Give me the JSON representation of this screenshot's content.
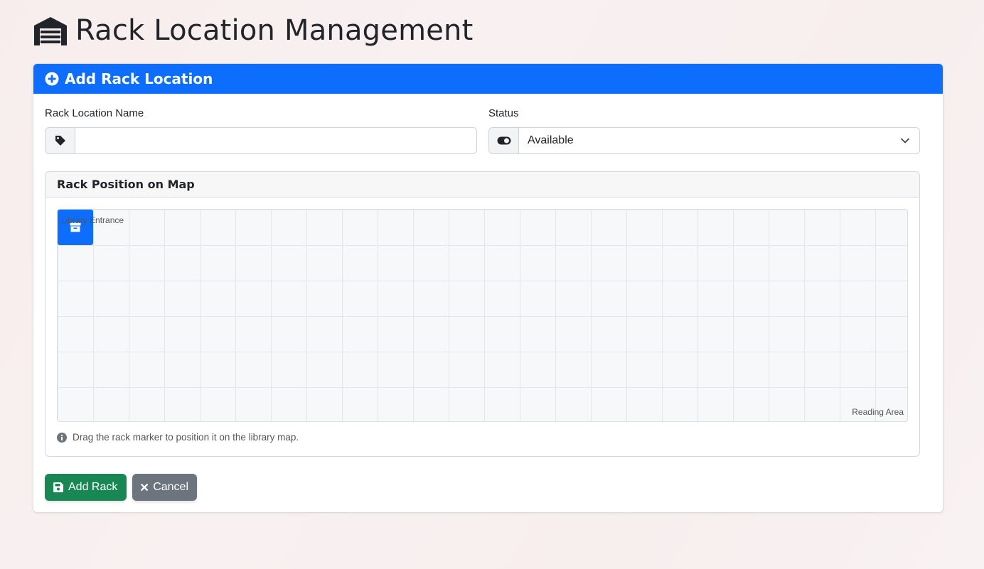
{
  "page": {
    "title": "Rack Location Management",
    "title_icon": "warehouse-icon"
  },
  "card": {
    "title": "Add Rack Location",
    "title_icon": "plus-circle-icon",
    "accent_color": "#0d6efd"
  },
  "form": {
    "name": {
      "label": "Rack Location Name",
      "value": "",
      "placeholder": "",
      "icon": "tag-icon"
    },
    "status": {
      "label": "Status",
      "selected": "Available",
      "icon": "toggle-icon"
    }
  },
  "map": {
    "title": "Rack Position on Map",
    "entrance_label": "Library Entrance",
    "reading_label": "Reading Area",
    "marker_icon": "archive-icon",
    "marker_color": "#0d6efd",
    "help_text": "Drag the rack marker to position it on the library map."
  },
  "actions": {
    "add_label": "Add Rack",
    "add_color": "#198754",
    "cancel_label": "Cancel",
    "cancel_color": "#6c757d"
  }
}
